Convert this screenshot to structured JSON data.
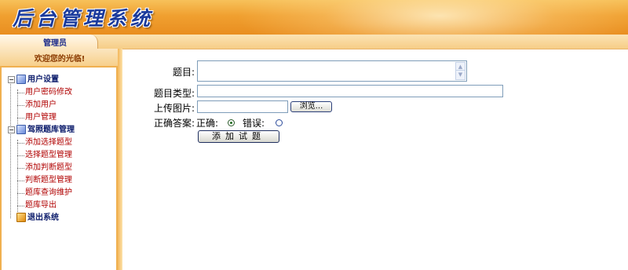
{
  "header": {
    "title": "后台管理系统"
  },
  "tab": {
    "label": "管理员"
  },
  "sidebar": {
    "welcome": "欢迎您的光临!",
    "groups": [
      {
        "label": "用户设置",
        "items": [
          "用户密码修改",
          "添加用户",
          "用户管理"
        ]
      },
      {
        "label": "驾照题库管理",
        "items": [
          "添加选择题型",
          "选择题型管理",
          "添加判断题型",
          "判断题型管理",
          "题库查询维护",
          "题库导出"
        ]
      },
      {
        "label": "退出系统",
        "items": []
      }
    ]
  },
  "form": {
    "question_label": "题目:",
    "question_value": "",
    "type_label": "题目类型:",
    "type_value": "",
    "image_label": "上传图片:",
    "image_value": "",
    "browse_label": "浏览...",
    "answer_label": "正确答案:",
    "answer_correct_label": "正确:",
    "answer_wrong_label": "错误:",
    "answer_selected": "correct",
    "submit_label": "添加试题"
  },
  "colors": {
    "banner": "#f0a030",
    "title": "#1a3a9c",
    "leaf_text": "#b00000",
    "group_text": "#0a1a6a"
  }
}
